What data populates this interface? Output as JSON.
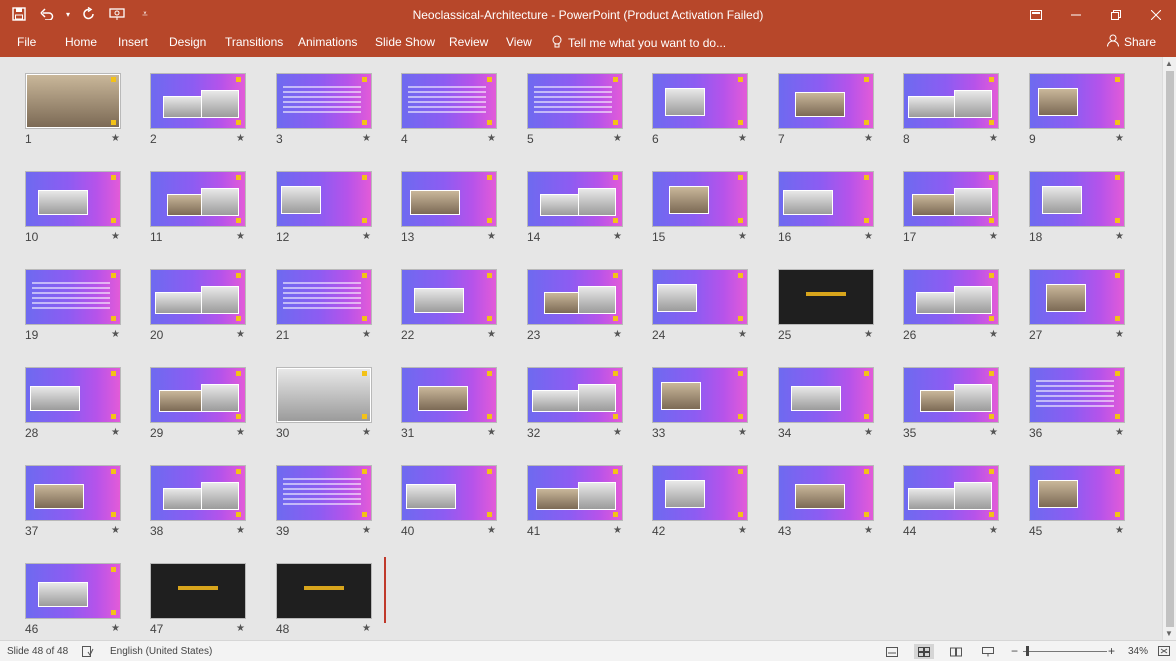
{
  "window": {
    "title": "Neoclassical-Architecture - PowerPoint (Product Activation Failed)",
    "qat_icons": [
      "save-icon",
      "undo-icon",
      "undo-dropdown-icon",
      "redo-icon",
      "slideshow-icon",
      "customize-qat-icon"
    ],
    "controls": [
      "ribbon-display-icon",
      "minimize-icon",
      "restore-icon",
      "close-icon"
    ]
  },
  "ribbon": {
    "file": "File",
    "tabs": [
      "Home",
      "Insert",
      "Design",
      "Transitions",
      "Animations",
      "Slide Show",
      "Review",
      "View"
    ],
    "tell_me": "Tell me what you want to do...",
    "share": "Share"
  },
  "slides": [
    "1",
    "2",
    "3",
    "4",
    "5",
    "6",
    "7",
    "8",
    "9",
    "10",
    "11",
    "12",
    "13",
    "14",
    "15",
    "16",
    "17",
    "18",
    "19",
    "20",
    "21",
    "22",
    "23",
    "24",
    "25",
    "26",
    "27",
    "28",
    "29",
    "30",
    "31",
    "32",
    "33",
    "34",
    "35",
    "36",
    "37",
    "38",
    "39",
    "40",
    "41",
    "42",
    "43",
    "44",
    "45",
    "46",
    "47",
    "48"
  ],
  "status": {
    "slide_of": "Slide 48 of 48",
    "language": "English (United States)",
    "zoom": "34%",
    "zoom_minus": "−",
    "zoom_plus": "+"
  },
  "colors": {
    "brand": "#b7472a",
    "slide_gradient_start": "#6e6af0",
    "slide_gradient_end": "#e35bd8",
    "accent_yellow": "#f3c217"
  }
}
